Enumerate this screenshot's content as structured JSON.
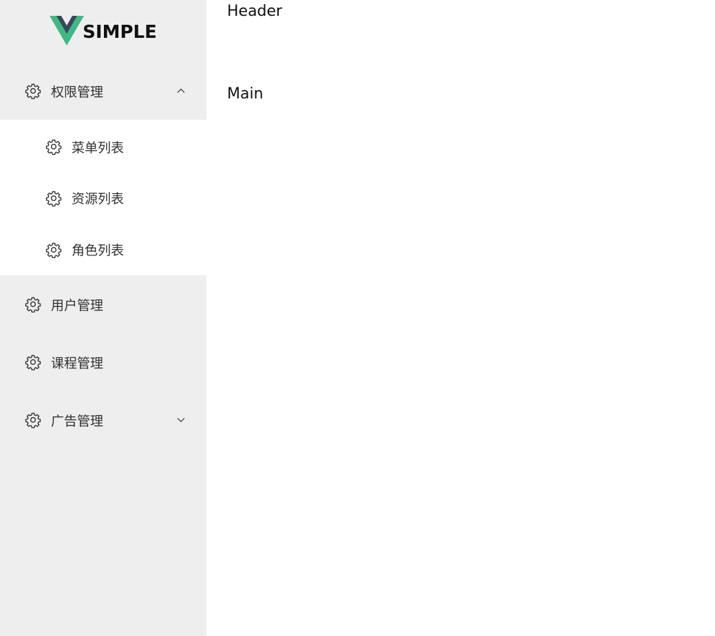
{
  "logo": {
    "text": "SIMPLE",
    "colors": {
      "outer": "#41b883",
      "inner": "#35495e"
    }
  },
  "sidebar": {
    "background": "#eeeeee",
    "menus": [
      {
        "label": "权限管理",
        "icon": "gear-icon",
        "expanded": true,
        "children": [
          {
            "label": "菜单列表",
            "icon": "gear-icon"
          },
          {
            "label": "资源列表",
            "icon": "gear-icon"
          },
          {
            "label": "角色列表",
            "icon": "gear-icon"
          }
        ]
      },
      {
        "label": "用户管理",
        "icon": "gear-icon"
      },
      {
        "label": "课程管理",
        "icon": "gear-icon"
      },
      {
        "label": "广告管理",
        "icon": "gear-icon",
        "expanded": false
      }
    ]
  },
  "header": {
    "text": "Header"
  },
  "main": {
    "text": "Main"
  }
}
